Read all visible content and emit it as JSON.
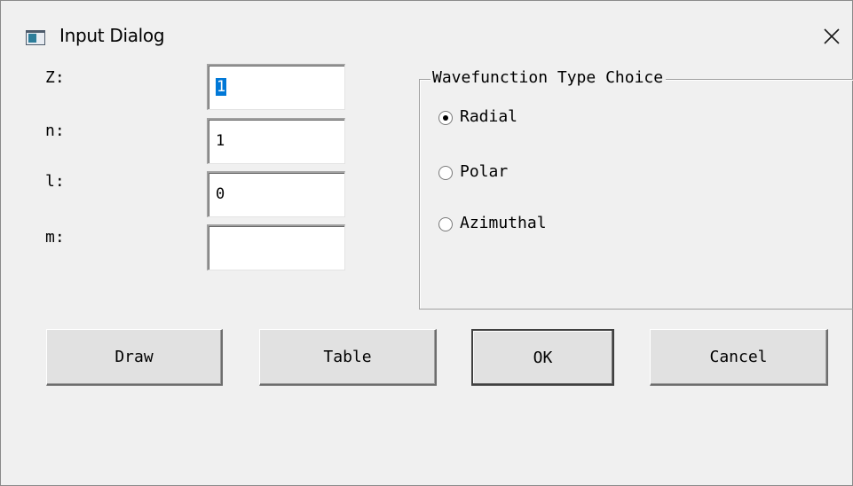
{
  "window": {
    "title": "Input Dialog",
    "icon": "app-window-icon",
    "close_icon": "close-icon"
  },
  "fields": [
    {
      "label": "Z:",
      "value": "1",
      "selected": true
    },
    {
      "label": "n:",
      "value": "1"
    },
    {
      "label": "l:",
      "value": "0"
    },
    {
      "label": "m:",
      "value": ""
    }
  ],
  "wavefunction": {
    "title": "Wavefunction Type Choice",
    "options": [
      {
        "label": "Radial",
        "checked": true
      },
      {
        "label": "Polar",
        "checked": false
      },
      {
        "label": "Azimuthal",
        "checked": false
      }
    ]
  },
  "buttons": {
    "draw": "Draw",
    "table": "Table",
    "ok": "OK",
    "cancel": "Cancel"
  },
  "colors": {
    "background": "#f0f0f0",
    "selection": "#0078d7",
    "button_face": "#e1e1e1"
  }
}
